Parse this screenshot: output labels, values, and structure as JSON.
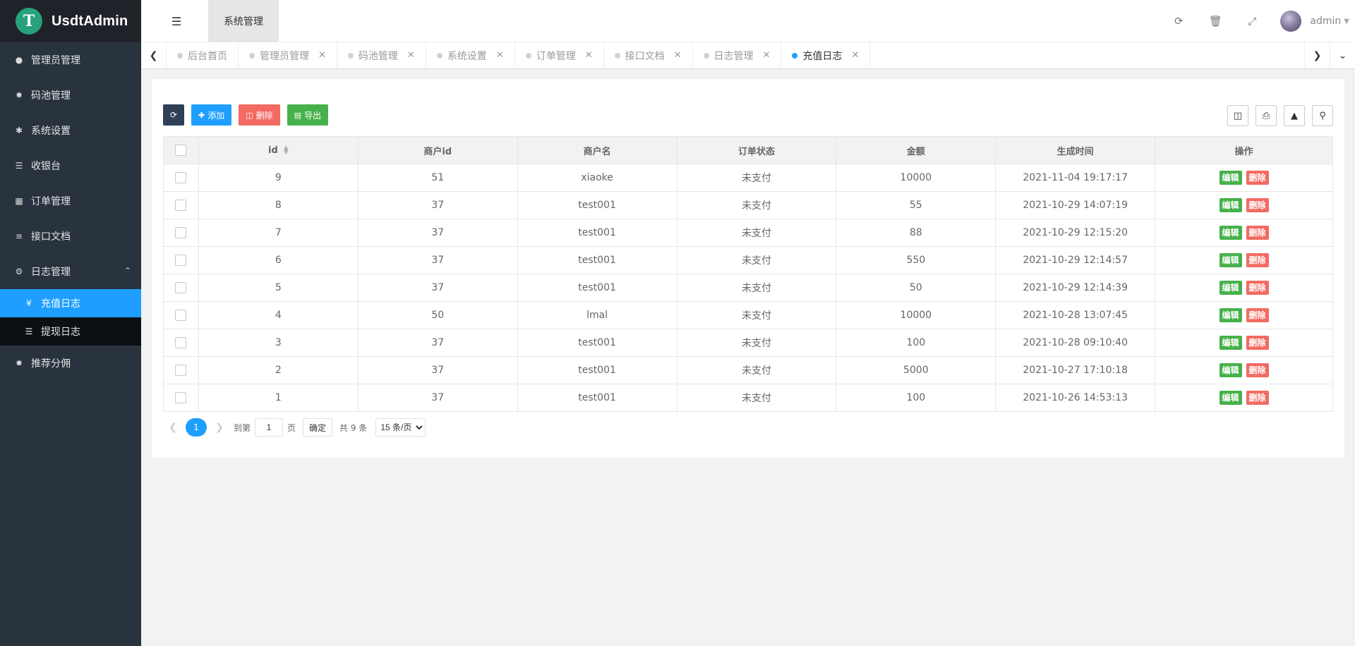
{
  "app": {
    "logo_letter": "T",
    "title": "UsdtAdmin"
  },
  "sidebar": {
    "items": [
      {
        "label": "管理员管理",
        "icon": "user-icon"
      },
      {
        "label": "码池管理",
        "icon": "android-icon"
      },
      {
        "label": "系统设置",
        "icon": "asterisk-icon"
      },
      {
        "label": "收银台",
        "icon": "list-icon"
      },
      {
        "label": "订单管理",
        "icon": "calculator-icon"
      },
      {
        "label": "接口文档",
        "icon": "align-left-icon"
      },
      {
        "label": "日志管理",
        "icon": "gears-icon",
        "expanded": true
      }
    ],
    "sub_items": [
      {
        "label": "充值日志",
        "icon": "yen-icon",
        "active": true
      },
      {
        "label": "提现日志",
        "icon": "list-icon"
      }
    ],
    "after_items": [
      {
        "label": "推荐分佣",
        "icon": "android-icon"
      }
    ]
  },
  "header": {
    "system_tab": "系统管理",
    "username": "admin"
  },
  "tabs": [
    {
      "label": "后台首页",
      "closable": false
    },
    {
      "label": "管理员管理",
      "closable": true
    },
    {
      "label": "码池管理",
      "closable": true
    },
    {
      "label": "系统设置",
      "closable": true
    },
    {
      "label": "订单管理",
      "closable": true
    },
    {
      "label": "接口文档",
      "closable": true
    },
    {
      "label": "日志管理",
      "closable": true
    },
    {
      "label": "充值日志",
      "closable": true,
      "active": true
    }
  ],
  "toolbar": {
    "add": "添加",
    "delete": "删除",
    "export": "导出"
  },
  "table": {
    "columns": [
      "id",
      "商户id",
      "商户名",
      "订单状态",
      "金额",
      "生成时间",
      "操作"
    ],
    "rows": [
      [
        "9",
        "51",
        "xiaoke",
        "未支付",
        "10000",
        "2021-11-04 19:17:17"
      ],
      [
        "8",
        "37",
        "test001",
        "未支付",
        "55",
        "2021-10-29 14:07:19"
      ],
      [
        "7",
        "37",
        "test001",
        "未支付",
        "88",
        "2021-10-29 12:15:20"
      ],
      [
        "6",
        "37",
        "test001",
        "未支付",
        "550",
        "2021-10-29 12:14:57"
      ],
      [
        "5",
        "37",
        "test001",
        "未支付",
        "50",
        "2021-10-29 12:14:39"
      ],
      [
        "4",
        "50",
        "lmal",
        "未支付",
        "10000",
        "2021-10-28 13:07:45"
      ],
      [
        "3",
        "37",
        "test001",
        "未支付",
        "100",
        "2021-10-28 09:10:40"
      ],
      [
        "2",
        "37",
        "test001",
        "未支付",
        "5000",
        "2021-10-27 17:10:18"
      ],
      [
        "1",
        "37",
        "test001",
        "未支付",
        "100",
        "2021-10-26 14:53:13"
      ]
    ],
    "edit_label": "编辑",
    "remove_label": "删除"
  },
  "pagination": {
    "current": "1",
    "goto_label": "到第",
    "page_value": "1",
    "page_suffix": "页",
    "confirm": "确定",
    "total": "共 9 条",
    "page_size": "15 条/页"
  },
  "colors": {
    "accent": "#1e9fff",
    "sidebar": "#28333e",
    "success": "#46b14a",
    "danger": "#f26a62"
  }
}
